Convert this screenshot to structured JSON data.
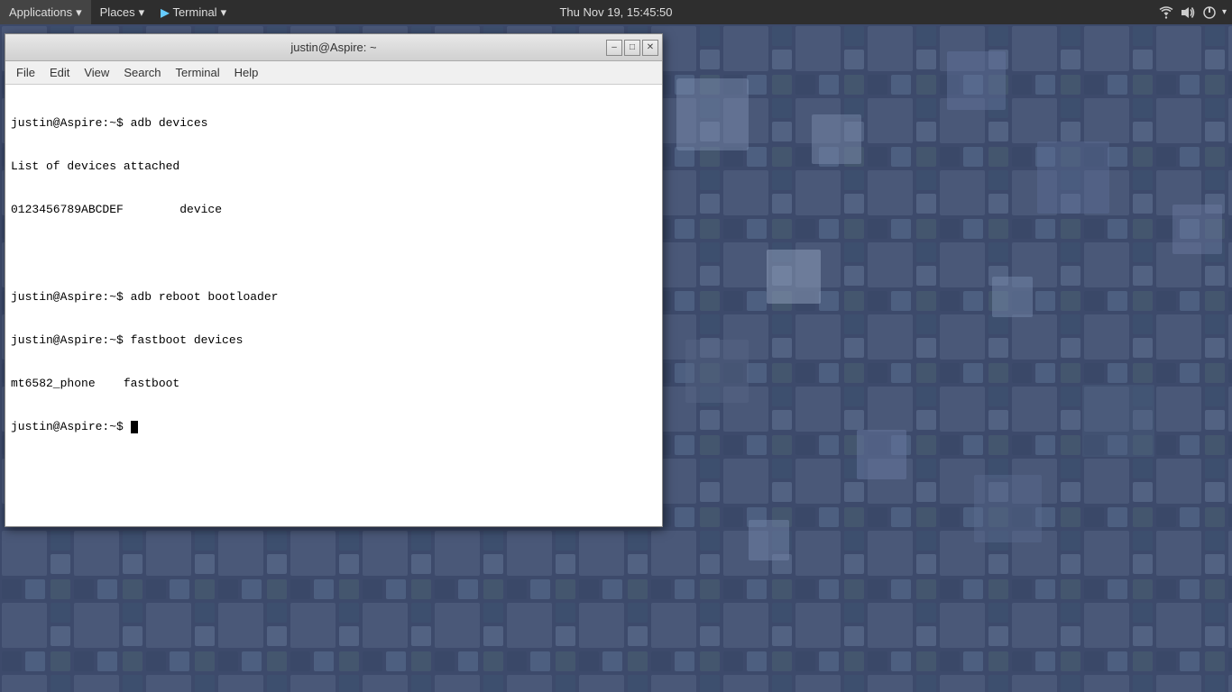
{
  "taskbar": {
    "applications_label": "Applications",
    "places_label": "Places",
    "terminal_label": "Terminal",
    "clock": "Thu Nov 19, 15:45:50",
    "icons": {
      "wifi": "wifi-icon",
      "volume": "volume-icon",
      "power": "power-icon"
    }
  },
  "terminal_window": {
    "title": "justin@Aspire: ~",
    "minimize_label": "–",
    "maximize_label": "□",
    "close_label": "✕",
    "menu": {
      "file": "File",
      "edit": "Edit",
      "view": "View",
      "search": "Search",
      "terminal": "Terminal",
      "help": "Help"
    },
    "content": [
      "justin@Aspire:~$ adb devices",
      "List of devices attached",
      "0123456789ABCDEF        device",
      "",
      "justin@Aspire:~$ adb reboot bootloader",
      "justin@Aspire:~$ fastboot devices",
      "mt6582_phone    fastboot",
      "justin@Aspire:~$ "
    ]
  },
  "desktop": {
    "bg_color": "#3d4a6b"
  }
}
